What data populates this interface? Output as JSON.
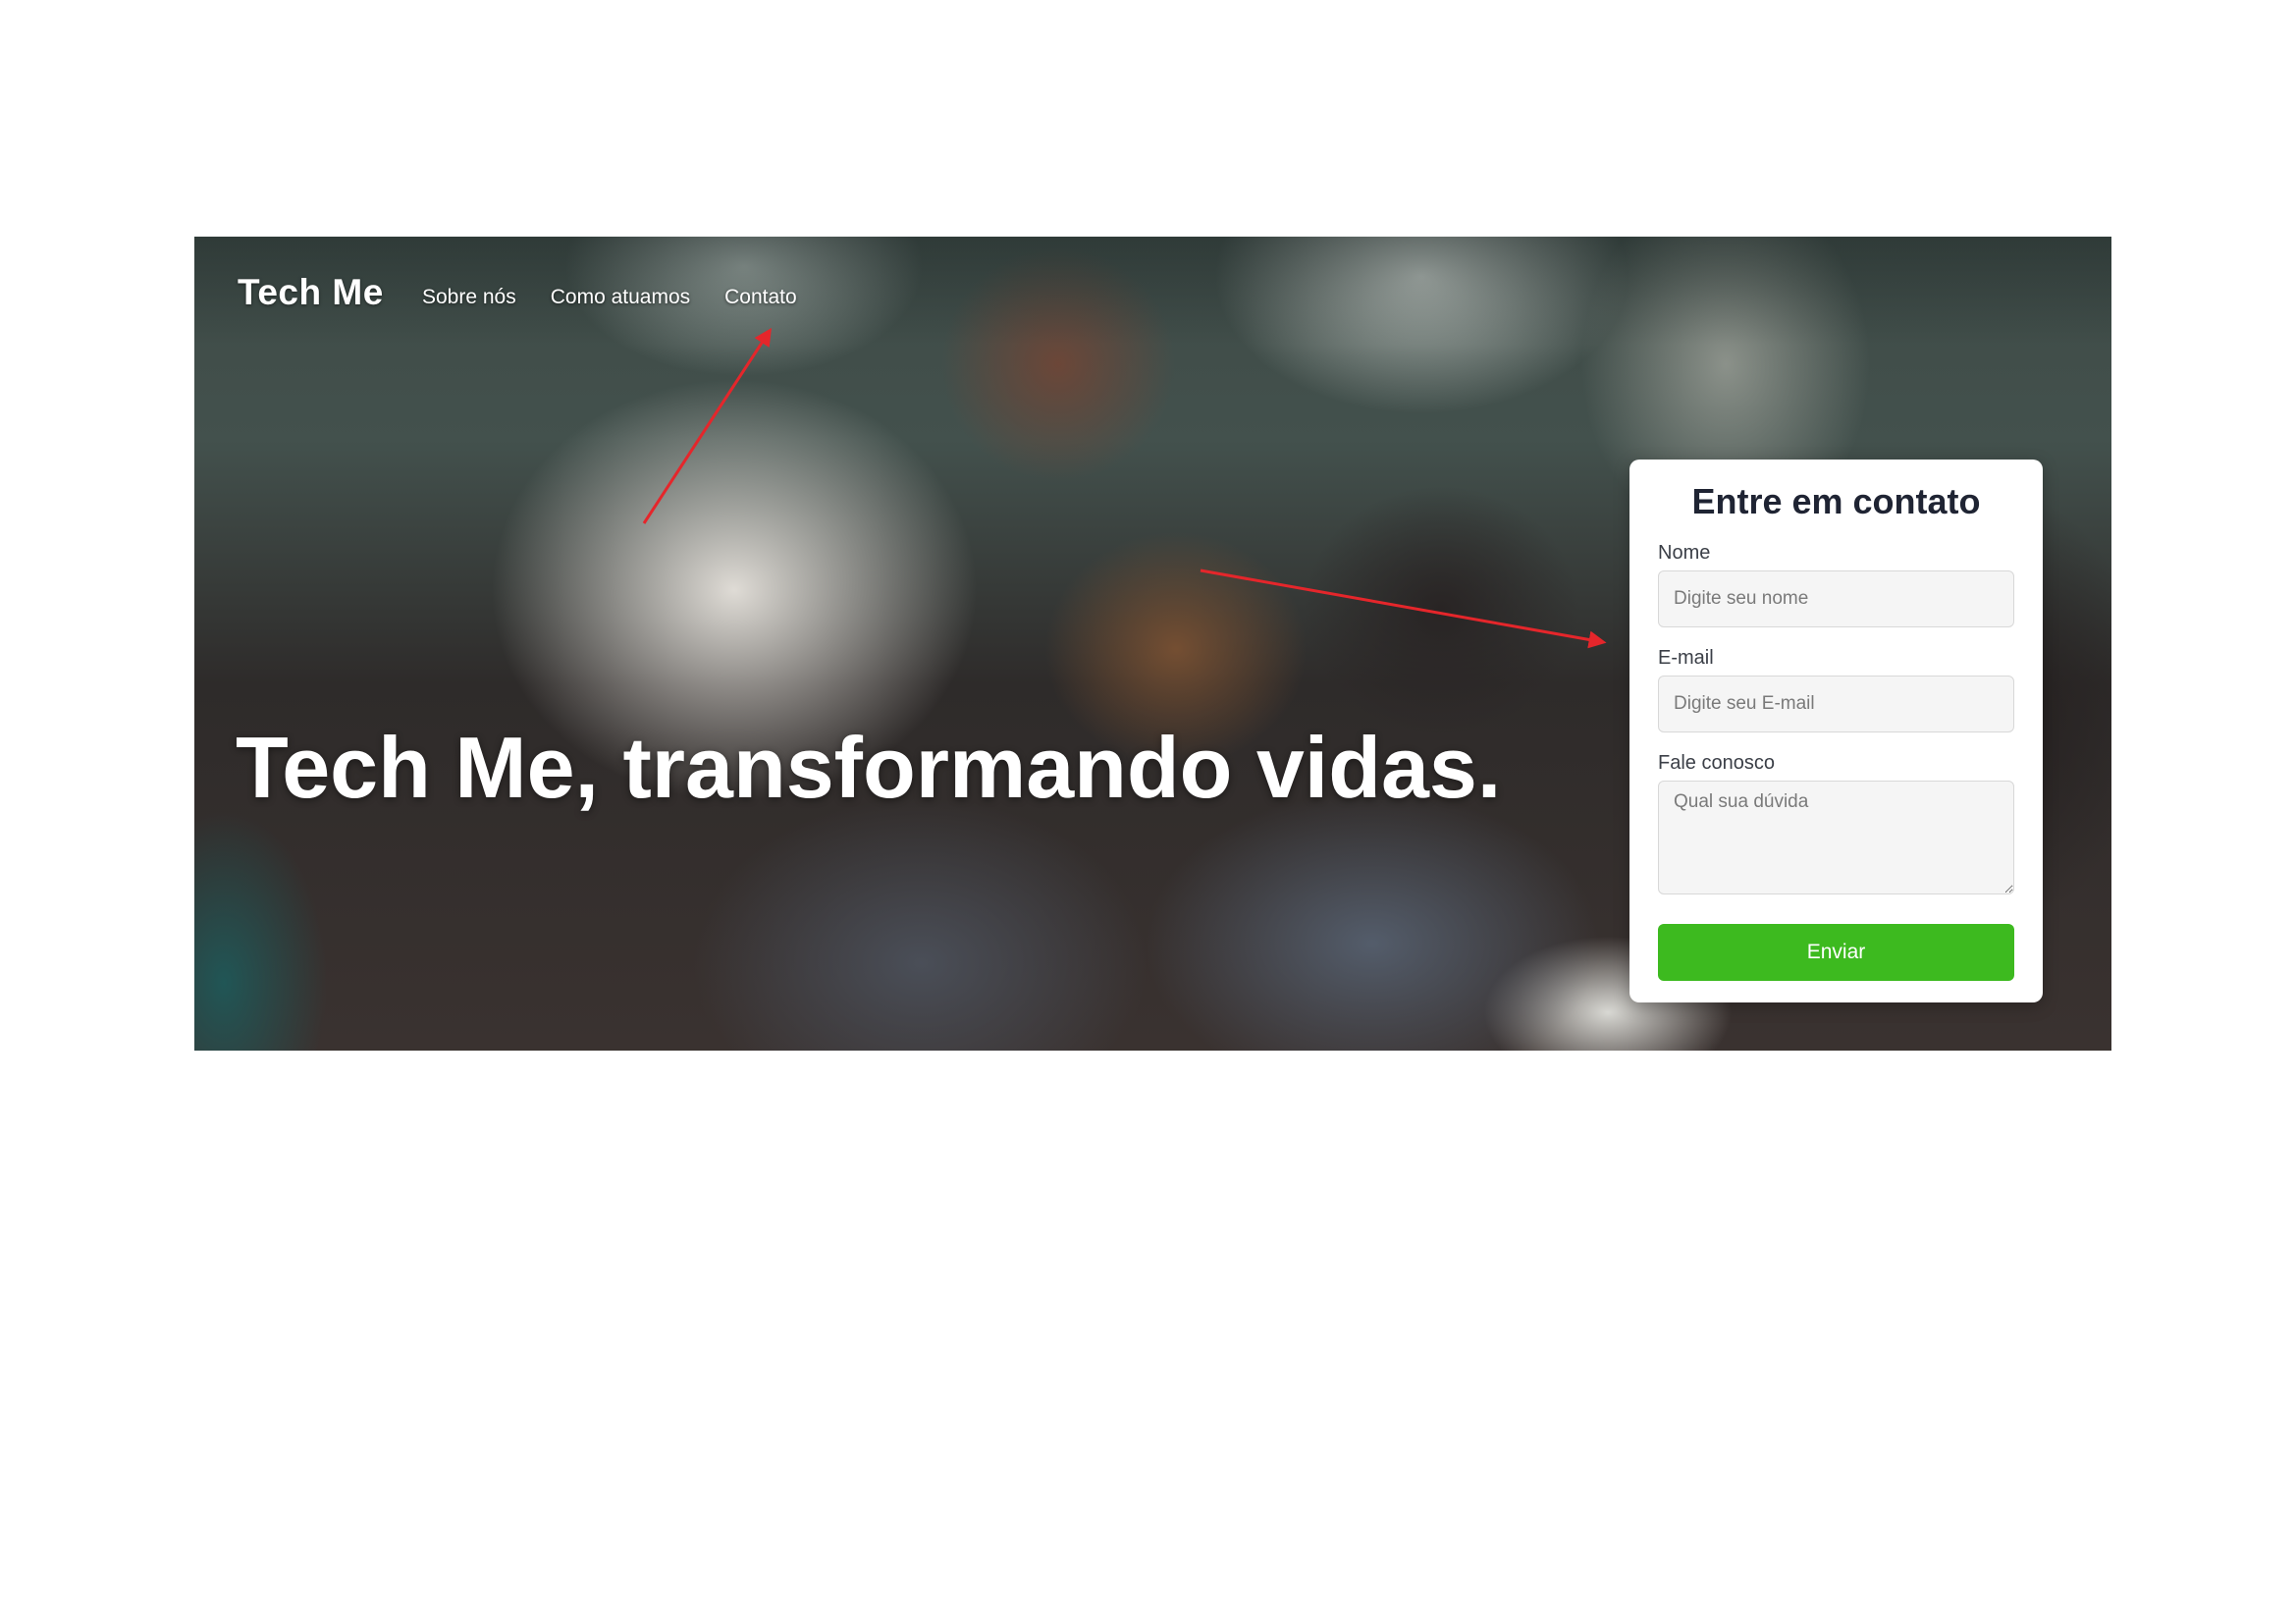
{
  "header": {
    "brand": "Tech Me",
    "nav": [
      {
        "label": "Sobre nós"
      },
      {
        "label": "Como atuamos"
      },
      {
        "label": "Contato"
      }
    ]
  },
  "hero": {
    "headline": "Tech Me, transformando vidas."
  },
  "contact_form": {
    "title": "Entre em contato",
    "name_label": "Nome",
    "name_placeholder": "Digite seu nome",
    "email_label": "E-mail",
    "email_placeholder": "Digite seu E-mail",
    "message_label": "Fale conosco",
    "message_placeholder": "Qual sua dúvida",
    "submit_label": "Enviar",
    "submit_color": "#3dba1f"
  },
  "annotation_color": "#e5262b"
}
